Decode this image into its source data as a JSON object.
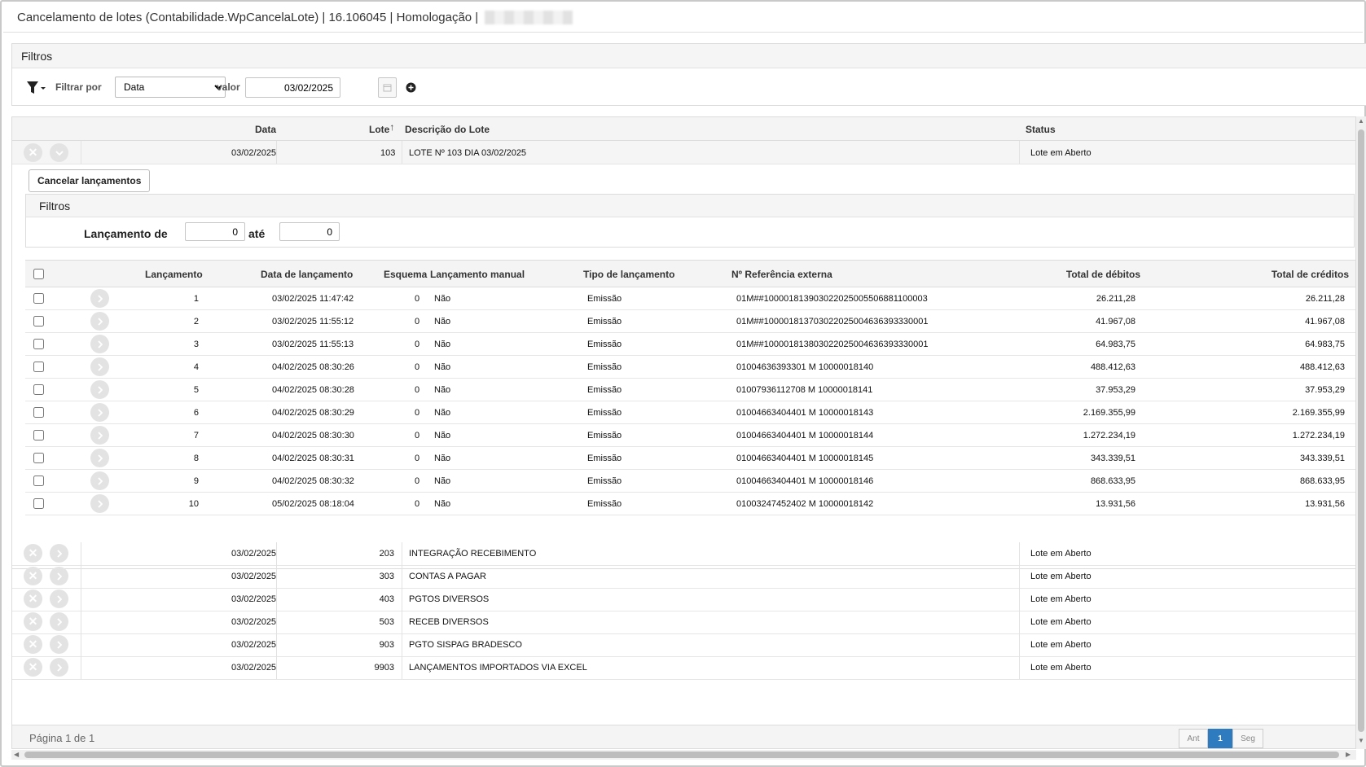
{
  "window": {
    "title": "Cancelamento de lotes (Contabilidade.WpCancelaLote) | 16.106045 | Homologação |"
  },
  "filters": {
    "title": "Filtros",
    "filter_by_label": "Filtrar por",
    "filter_by_value": "Data",
    "value_label": "valor",
    "value": "03/02/2025"
  },
  "grid": {
    "headers": {
      "date": "Data",
      "lot": "Lote",
      "description": "Descrição do Lote",
      "status": "Status"
    },
    "sort_indicator": "↑",
    "expanded_lot": {
      "date": "03/02/2025",
      "lot": "103",
      "description": "LOTE Nº 103 DIA 03/02/2025",
      "status": "Lote em Aberto"
    },
    "other_lots": [
      {
        "date": "03/02/2025",
        "lot": "203",
        "description": "INTEGRAÇÃO RECEBIMENTO",
        "status": "Lote em Aberto"
      },
      {
        "date": "03/02/2025",
        "lot": "303",
        "description": "CONTAS A PAGAR",
        "status": "Lote em Aberto"
      },
      {
        "date": "03/02/2025",
        "lot": "403",
        "description": "PGTOS DIVERSOS",
        "status": "Lote em Aberto"
      },
      {
        "date": "03/02/2025",
        "lot": "503",
        "description": "RECEB DIVERSOS",
        "status": "Lote em Aberto"
      },
      {
        "date": "03/02/2025",
        "lot": "903",
        "description": "PGTO SISPAG BRADESCO",
        "status": "Lote em Aberto"
      },
      {
        "date": "03/02/2025",
        "lot": "9903",
        "description": "LANÇAMENTOS IMPORTADOS VIA EXCEL",
        "status": "Lote em Aberto"
      }
    ]
  },
  "detail": {
    "cancel_button": "Cancelar lançamentos",
    "filters_title": "Filtros",
    "range_from_label": "Lançamento de",
    "range_from_value": "0",
    "range_to_label": "até",
    "range_to_value": "0",
    "headers": {
      "entry": "Lançamento",
      "entry_date": "Data de lançamento",
      "scheme": "Esquema",
      "manual": "Lançamento manual",
      "type": "Tipo de lançamento",
      "external_ref": "Nº Referência externa",
      "total_debits": "Total de débitos",
      "total_credits": "Total de créditos"
    },
    "rows": [
      {
        "entry": "1",
        "entry_date": "03/02/2025 11:47:42",
        "scheme": "0",
        "manual": "Não",
        "type": "Emissão",
        "external_ref": "01M##100001813903022025005506881100003",
        "debits": "26.211,28",
        "credits": "26.211,28"
      },
      {
        "entry": "2",
        "entry_date": "03/02/2025 11:55:12",
        "scheme": "0",
        "manual": "Não",
        "type": "Emissão",
        "external_ref": "01M##100001813703022025004636393330001",
        "debits": "41.967,08",
        "credits": "41.967,08"
      },
      {
        "entry": "3",
        "entry_date": "03/02/2025 11:55:13",
        "scheme": "0",
        "manual": "Não",
        "type": "Emissão",
        "external_ref": "01M##100001813803022025004636393330001",
        "debits": "64.983,75",
        "credits": "64.983,75"
      },
      {
        "entry": "4",
        "entry_date": "04/02/2025 08:30:26",
        "scheme": "0",
        "manual": "Não",
        "type": "Emissão",
        "external_ref": "01004636393301 M 10000018140",
        "debits": "488.412,63",
        "credits": "488.412,63"
      },
      {
        "entry": "5",
        "entry_date": "04/02/2025 08:30:28",
        "scheme": "0",
        "manual": "Não",
        "type": "Emissão",
        "external_ref": "01007936112708 M 10000018141",
        "debits": "37.953,29",
        "credits": "37.953,29"
      },
      {
        "entry": "6",
        "entry_date": "04/02/2025 08:30:29",
        "scheme": "0",
        "manual": "Não",
        "type": "Emissão",
        "external_ref": "01004663404401 M 10000018143",
        "debits": "2.169.355,99",
        "credits": "2.169.355,99"
      },
      {
        "entry": "7",
        "entry_date": "04/02/2025 08:30:30",
        "scheme": "0",
        "manual": "Não",
        "type": "Emissão",
        "external_ref": "01004663404401 M 10000018144",
        "debits": "1.272.234,19",
        "credits": "1.272.234,19"
      },
      {
        "entry": "8",
        "entry_date": "04/02/2025 08:30:31",
        "scheme": "0",
        "manual": "Não",
        "type": "Emissão",
        "external_ref": "01004663404401 M 10000018145",
        "debits": "343.339,51",
        "credits": "343.339,51"
      },
      {
        "entry": "9",
        "entry_date": "04/02/2025 08:30:32",
        "scheme": "0",
        "manual": "Não",
        "type": "Emissão",
        "external_ref": "01004663404401 M 10000018146",
        "debits": "868.633,95",
        "credits": "868.633,95"
      },
      {
        "entry": "10",
        "entry_date": "05/02/2025 08:18:04",
        "scheme": "0",
        "manual": "Não",
        "type": "Emissão",
        "external_ref": "01003247452402 M 10000018142",
        "debits": "13.931,56",
        "credits": "13.931,56"
      }
    ]
  },
  "pager": {
    "info": "Página 1 de 1",
    "prev": "Ant",
    "current": "1",
    "next": "Seg"
  }
}
